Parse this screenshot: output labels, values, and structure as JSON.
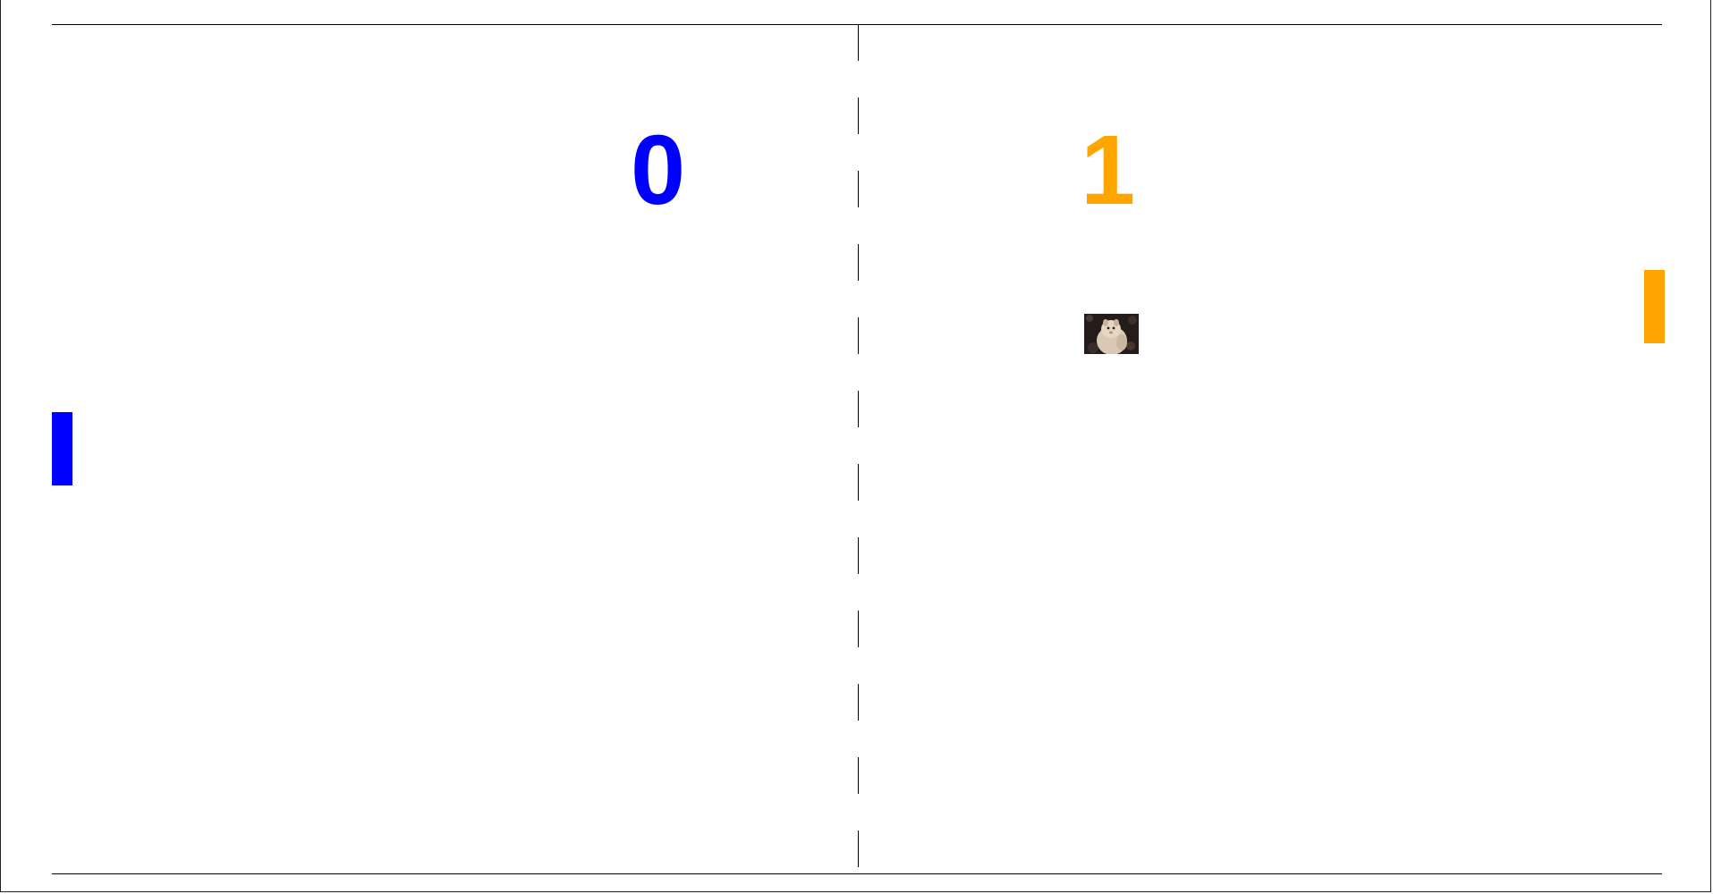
{
  "game": {
    "type": "pong",
    "left_player": {
      "score": "0",
      "color": "#0000ff"
    },
    "right_player": {
      "score": "1",
      "color": "#ffa500"
    },
    "ball": {
      "icon": "photo-ball-icon"
    }
  }
}
